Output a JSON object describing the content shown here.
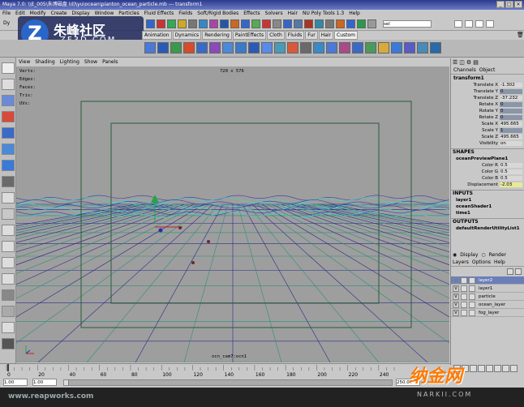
{
  "window": {
    "title": "Maya 7.0: \\\\E_005\\朱博磁盘 (d)\\yu\\ocean\\pianton_ocean_particle.mb --- transform1"
  },
  "menu": [
    "File",
    "Edit",
    "Modify",
    "Create",
    "Display",
    "Window",
    "Particles",
    "Fluid Effects",
    "Fields",
    "Soft/Rigid Bodies",
    "Effects",
    "Solvers",
    "Hair",
    "NU Poly Tools 1.3",
    "Help"
  ],
  "status": {
    "mode_label": "Dy",
    "search_value": "sel"
  },
  "shelf_tabs": [
    "Animation",
    "Dynamics",
    "Rendering",
    "PaintEffects",
    "Cloth",
    "Fluids",
    "Fur",
    "Hair",
    "Custom"
  ],
  "shelf_active": "Custom",
  "viewport_menu": [
    "View",
    "Shading",
    "Lighting",
    "Show",
    "Panels"
  ],
  "hud": {
    "verts": "Verts:",
    "edges": "Edges:",
    "faces": "Faces:",
    "tris": "Tris:",
    "uvs": "UVs:",
    "resolution": "720 x 576",
    "camera": "ocn_cam7:ocn1"
  },
  "channel_box": {
    "tabs": [
      "Channels",
      "Object"
    ],
    "node": "transform1",
    "rows": [
      {
        "label": "Translate X",
        "value": "-1.302"
      },
      {
        "label": "Translate Y",
        "value": "0"
      },
      {
        "label": "Translate Z",
        "value": "-37.232"
      },
      {
        "label": "Rotate X",
        "value": "0"
      },
      {
        "label": "Rotate Y",
        "value": "0"
      },
      {
        "label": "Rotate Z",
        "value": "0"
      },
      {
        "label": "Scale X",
        "value": "495.665"
      },
      {
        "label": "Scale Y",
        "value": "1"
      },
      {
        "label": "Scale Z",
        "value": "495.665"
      },
      {
        "label": "Visibility",
        "value": "on"
      }
    ],
    "shapes_label": "SHAPES",
    "shape_node": "oceanPreviewPlane1",
    "shape_rows": [
      {
        "label": "Color R",
        "value": "0.5"
      },
      {
        "label": "Color G",
        "value": "0.5"
      },
      {
        "label": "Color B",
        "value": "0.5"
      },
      {
        "label": "Displacement",
        "value": "-2.03"
      }
    ],
    "inputs_label": "INPUTS",
    "inputs": [
      "layer1",
      "oceanShader1",
      "time1"
    ],
    "outputs_label": "OUTPUTS",
    "outputs": [
      "defaultRenderUtilityList1"
    ]
  },
  "layers": {
    "display_label": "Display",
    "render_label": "Render",
    "menu": [
      "Layers",
      "Options",
      "Help"
    ],
    "items": [
      {
        "visible": "",
        "name": "layer2"
      },
      {
        "visible": "V",
        "name": "layer1"
      },
      {
        "visible": "V",
        "name": "particle"
      },
      {
        "visible": "V",
        "name": "ocean_layer"
      },
      {
        "visible": "V",
        "name": "fog_layer"
      }
    ]
  },
  "time": {
    "ticks": [
      "0",
      "20",
      "40",
      "60",
      "80",
      "100",
      "120",
      "140",
      "160",
      "180",
      "200",
      "220",
      "240"
    ],
    "start": "1.00",
    "start2": "1.00",
    "end": "250.00",
    "current": "1"
  },
  "watermarks": {
    "site_top": "朱峰社区",
    "site_top_url": "ZF3D.COM",
    "site_bottom": "www.reapworks.com",
    "site_right": "纳金网",
    "site_right_url": "NARKII.COM"
  }
}
